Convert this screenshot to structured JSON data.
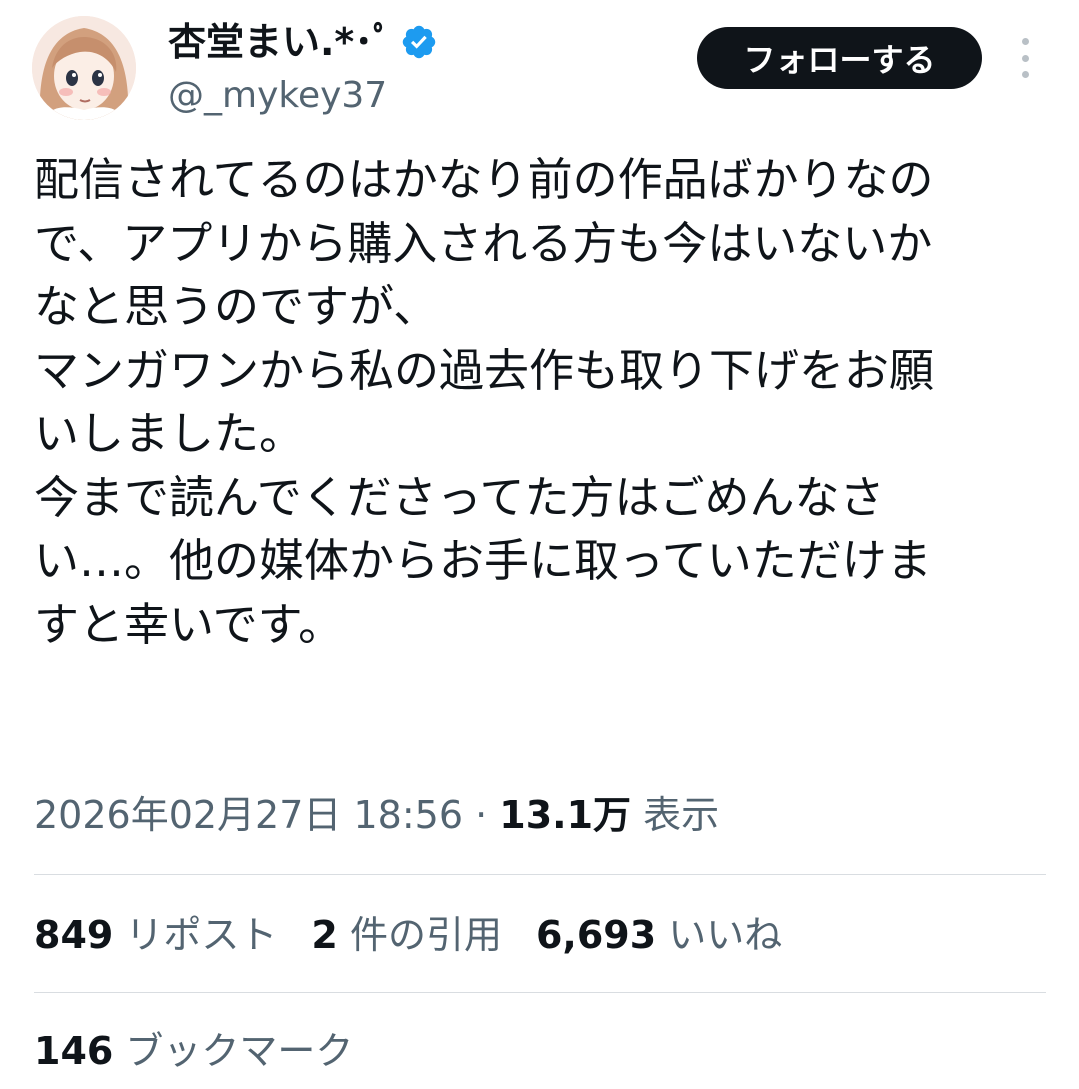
{
  "author": {
    "display_name": "杏堂まい.*･ﾟ",
    "handle": "@_mykey37",
    "verified_icon": "verified-badge-icon",
    "avatar_icon": "anime-girl-avatar"
  },
  "follow_label": "フォローする",
  "more_icon": "more-vertical-icon",
  "tweet_lines": [
    "配信されてるのはかなり前の作品ばかりなの",
    "で、アプリから購入される方も今はいないか",
    "なと思うのですが、",
    "マンガワンから私の過去作も取り下げをお願",
    "いしました。",
    "今まで読んでくださってた方はごめんなさ",
    "い…。他の媒体からお手に取っていただけま",
    "すと幸いです。"
  ],
  "meta": {
    "datetime": "2026年02月27日 18:56",
    "separator": " · ",
    "views_count": "13.1万",
    "views_label": " 表示"
  },
  "stats": [
    {
      "count": "849",
      "label": " リポスト"
    },
    {
      "count": "2",
      "label": " 件の引用"
    },
    {
      "count": "6,693",
      "label": " いいね"
    }
  ],
  "bookmarks": {
    "count": "146",
    "label": " ブックマーク"
  },
  "colors": {
    "text_primary": "#0f1419",
    "text_secondary": "#536471",
    "verified_blue": "#1d9bf0",
    "divider": "#d9dde1",
    "button_bg": "#0f1419"
  }
}
